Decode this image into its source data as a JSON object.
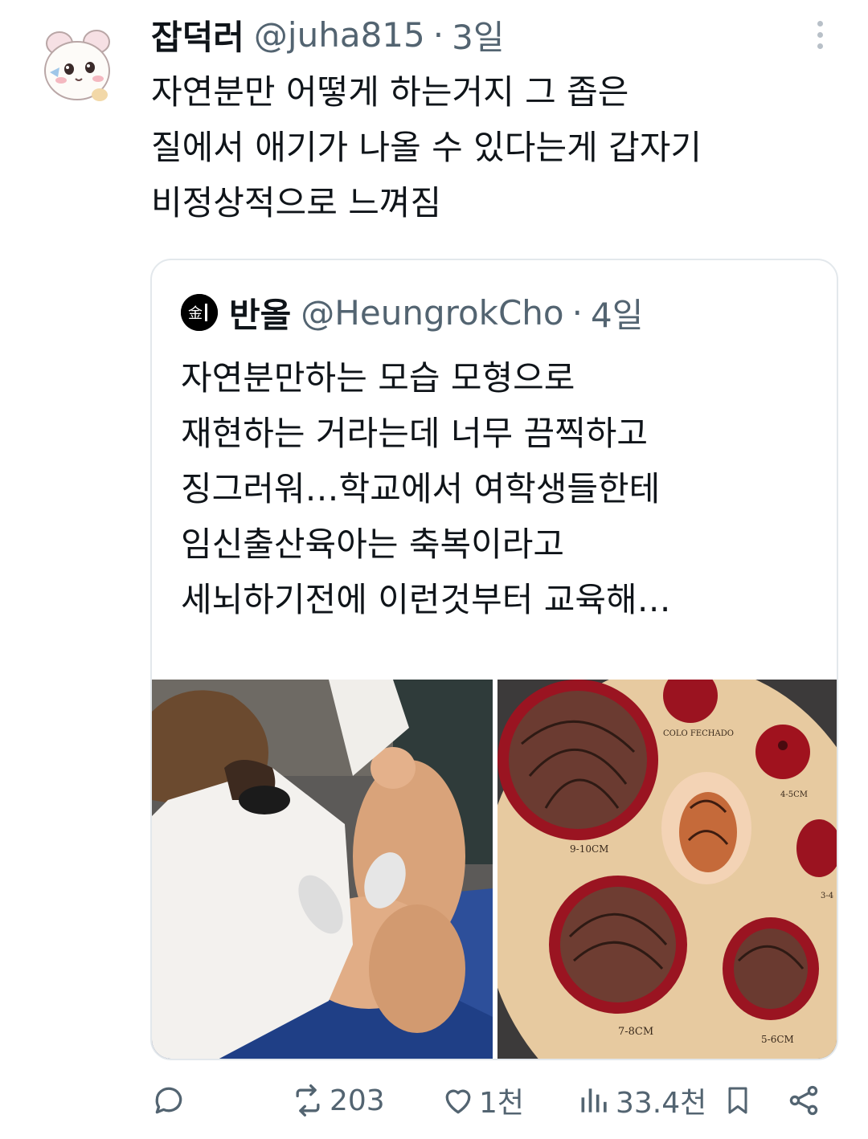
{
  "tweet": {
    "display_name": "잡덕러",
    "handle": "@juha815",
    "separator": "·",
    "time": "3일",
    "text_lines": [
      "자연분만 어떻게 하는거지 그 좁은",
      "질에서 애기가 나올 수 있다는게 갑자기",
      "비정상적으로 느껴짐"
    ]
  },
  "quoted": {
    "display_name": "반올",
    "handle": "@HeungrokCho",
    "separator": "·",
    "time": "4일",
    "text_lines": [
      "자연분만하는 모습 모형으로",
      "재현하는 거라는데 너무 끔찍하고",
      "징그러워…학교에서 여학생들한테",
      "임신출산육아는 축복이라고",
      "세뇌하기전에 이런것부터 교육해…"
    ],
    "media": {
      "right_labels": [
        "COLO FECHADO",
        "4-5CM",
        "9-10CM",
        "3-4",
        "7-8CM",
        "5-6CM"
      ]
    }
  },
  "actions": {
    "reply": {
      "icon": "reply-icon",
      "count": ""
    },
    "retweet": {
      "icon": "retweet-icon",
      "count": "203"
    },
    "like": {
      "icon": "heart-icon",
      "count": "1천"
    },
    "views": {
      "icon": "views-icon",
      "count": "33.4천"
    },
    "bookmark": {
      "icon": "bookmark-icon"
    },
    "share": {
      "icon": "share-icon"
    }
  },
  "colors": {
    "text": "#0f1419",
    "secondary": "#536471",
    "border": "#e3e8ec"
  }
}
